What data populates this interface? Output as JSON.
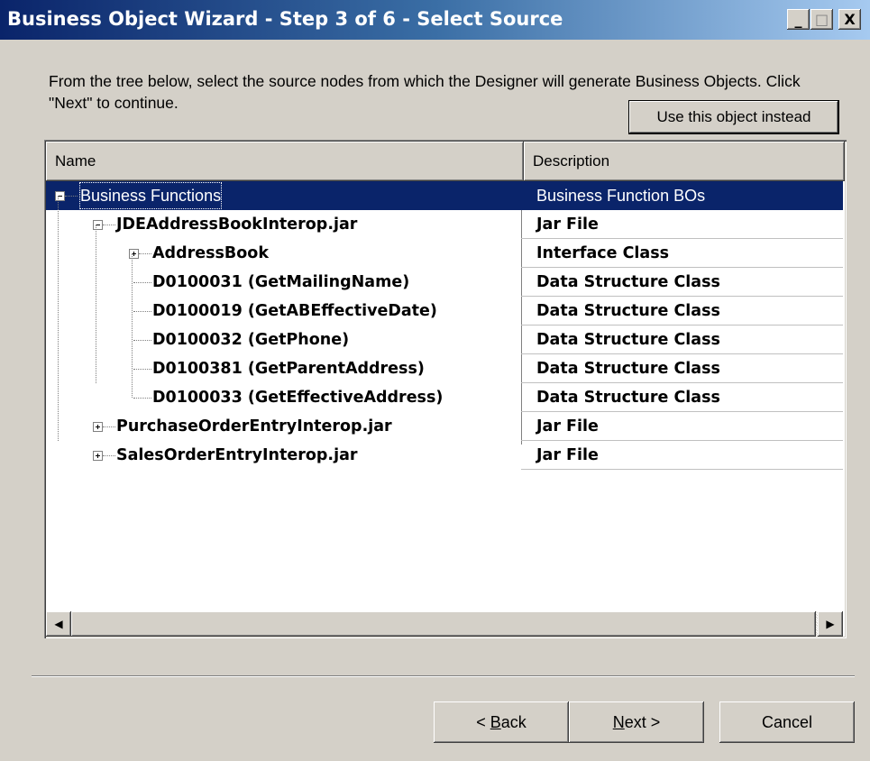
{
  "window": {
    "title": "Business Object Wizard - Step 3 of 6 - Select Source",
    "minimize_glyph": "_",
    "maximize_glyph": "□",
    "close_glyph": "X"
  },
  "instructions": "From the tree below, select the source nodes from which the Designer will generate Business Objects. Click \"Next\" to continue.",
  "use_object_button": "Use this object instead",
  "columns": {
    "name": "Name",
    "description": "Description"
  },
  "tree": [
    {
      "name": "Business Functions",
      "description": "Business Function BOs",
      "level": 0,
      "expander": "minus",
      "selected": true,
      "bold": false
    },
    {
      "name": "JDEAddressBookInterop.jar",
      "description": "Jar File",
      "level": 1,
      "expander": "minus",
      "selected": false,
      "bold": true
    },
    {
      "name": "AddressBook",
      "description": "Interface Class",
      "level": 2,
      "expander": "plus",
      "selected": false,
      "bold": true
    },
    {
      "name": "D0100031 (GetMailingName)",
      "description": "Data Structure Class",
      "level": 2,
      "expander": "none",
      "selected": false,
      "bold": true
    },
    {
      "name": "D0100019 (GetABEffectiveDate)",
      "description": "Data Structure Class",
      "level": 2,
      "expander": "none",
      "selected": false,
      "bold": true
    },
    {
      "name": "D0100032 (GetPhone)",
      "description": "Data Structure Class",
      "level": 2,
      "expander": "none",
      "selected": false,
      "bold": true
    },
    {
      "name": "D0100381 (GetParentAddress)",
      "description": "Data Structure Class",
      "level": 2,
      "expander": "none",
      "selected": false,
      "bold": true
    },
    {
      "name": "D0100033 (GetEffectiveAddress)",
      "description": "Data Structure Class",
      "level": 2,
      "expander": "none",
      "selected": false,
      "bold": true
    },
    {
      "name": "PurchaseOrderEntryInterop.jar",
      "description": "Jar File",
      "level": 1,
      "expander": "plus",
      "selected": false,
      "bold": true
    },
    {
      "name": "SalesOrderEntryInterop.jar",
      "description": "Jar File",
      "level": 1,
      "expander": "plus",
      "selected": false,
      "bold": true
    }
  ],
  "scrollbar": {
    "left_arrow": "◀",
    "right_arrow": "▶"
  },
  "buttons": {
    "back": {
      "prefix": "< ",
      "mnemonic": "B",
      "rest": "ack"
    },
    "next": {
      "mnemonic": "N",
      "rest": "ext >"
    },
    "cancel": "Cancel"
  },
  "colors": {
    "selection": "#0a246a",
    "face": "#d4d0c8",
    "title_start": "#0a246a",
    "title_end": "#a6caf0"
  }
}
